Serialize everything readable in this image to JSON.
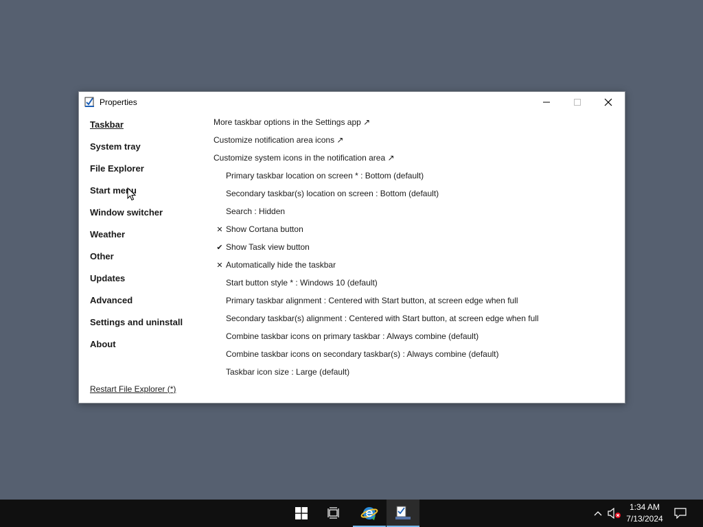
{
  "window": {
    "title": "Properties"
  },
  "sidebar": {
    "items": [
      {
        "label": "Taskbar",
        "active": true
      },
      {
        "label": "System tray"
      },
      {
        "label": "File Explorer"
      },
      {
        "label": "Start menu"
      },
      {
        "label": "Window switcher"
      },
      {
        "label": "Weather"
      },
      {
        "label": "Other"
      },
      {
        "label": "Updates"
      },
      {
        "label": "Advanced"
      },
      {
        "label": "Settings and uninstall"
      },
      {
        "label": "About"
      }
    ],
    "restart_link": "Restart File Explorer (*)"
  },
  "main": {
    "links": [
      "More taskbar options in the Settings app ↗",
      "Customize notification area icons ↗",
      "Customize system icons in the notification area ↗"
    ],
    "settings": [
      {
        "mark": "",
        "text": "Primary taskbar location on screen * : Bottom (default)"
      },
      {
        "mark": "",
        "text": "Secondary taskbar(s) location on screen : Bottom (default)"
      },
      {
        "mark": "",
        "text": "Search : Hidden"
      },
      {
        "mark": "✕",
        "text": "Show Cortana button"
      },
      {
        "mark": "✔",
        "text": "Show Task view button"
      },
      {
        "mark": "✕",
        "text": "Automatically hide the taskbar"
      },
      {
        "mark": "",
        "text": "Start button style * : Windows 10 (default)"
      },
      {
        "mark": "",
        "text": "Primary taskbar alignment : Centered with Start button, at screen edge when full"
      },
      {
        "mark": "",
        "text": "Secondary taskbar(s) alignment : Centered with Start button, at screen edge when full"
      },
      {
        "mark": "",
        "text": "Combine taskbar icons on primary taskbar : Always combine (default)"
      },
      {
        "mark": "",
        "text": "Combine taskbar icons on secondary taskbar(s) : Always combine (default)"
      },
      {
        "mark": "",
        "text": "Taskbar icon size : Large (default)"
      }
    ]
  },
  "taskbar": {
    "time": "1:34 AM",
    "date": "7/13/2024",
    "colors": {
      "background": "#101010",
      "active_indicator": "#76b9ed"
    }
  }
}
